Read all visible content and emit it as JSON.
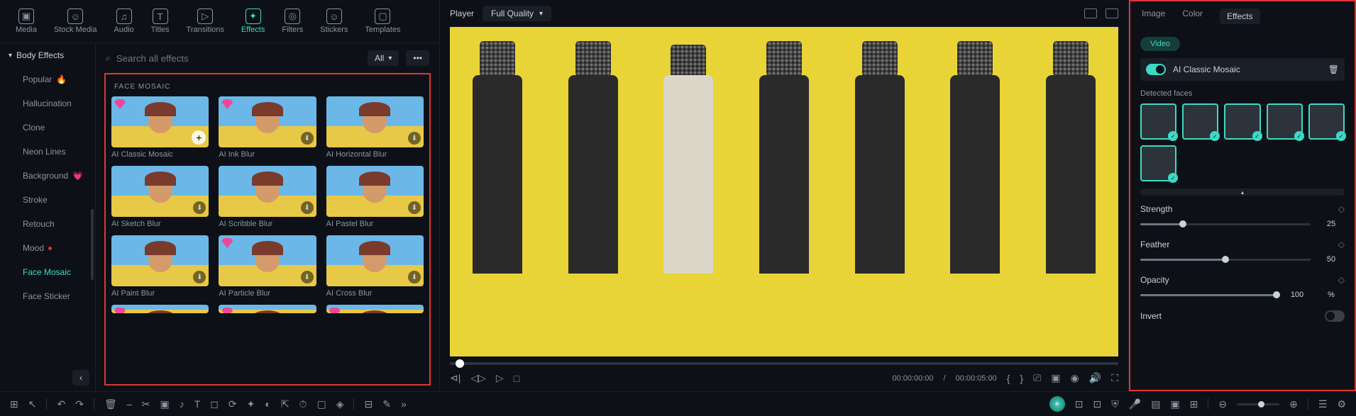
{
  "top_nav": [
    {
      "label": "Media",
      "icon": "▣"
    },
    {
      "label": "Stock Media",
      "icon": "☺"
    },
    {
      "label": "Audio",
      "icon": "♫"
    },
    {
      "label": "Titles",
      "icon": "T"
    },
    {
      "label": "Transitions",
      "icon": "▷"
    },
    {
      "label": "Effects",
      "icon": "✦",
      "active": true
    },
    {
      "label": "Filters",
      "icon": "◎"
    },
    {
      "label": "Stickers",
      "icon": "☺"
    },
    {
      "label": "Templates",
      "icon": "▢"
    }
  ],
  "sidebar": {
    "header": "Body Effects",
    "items": [
      {
        "label": "Popular",
        "emoji": "🔥"
      },
      {
        "label": "Hallucination"
      },
      {
        "label": "Clone"
      },
      {
        "label": "Neon Lines"
      },
      {
        "label": "Background",
        "emoji": "💗"
      },
      {
        "label": "Stroke"
      },
      {
        "label": "Retouch"
      },
      {
        "label": "Mood",
        "dot": true
      },
      {
        "label": "Face Mosaic",
        "active": true
      },
      {
        "label": "Face Sticker"
      }
    ]
  },
  "effects": {
    "search_placeholder": "Search all effects",
    "filter": "All",
    "section": "FACE MOSAIC",
    "items": [
      {
        "label": "AI Classic Mosaic",
        "gem": true,
        "add": true
      },
      {
        "label": "AI Ink Blur",
        "gem": true,
        "dl": true
      },
      {
        "label": "AI Horizontal Blur",
        "dl": true
      },
      {
        "label": "AI Sketch Blur",
        "dl": true
      },
      {
        "label": "AI Scribble Blur",
        "dl": true
      },
      {
        "label": "AI Pastel Blur",
        "dl": true
      },
      {
        "label": "AI Paint Blur",
        "dl": true
      },
      {
        "label": "AI Particle Blur",
        "gem": true,
        "dl": true
      },
      {
        "label": "AI Cross Blur",
        "dl": true
      }
    ]
  },
  "player": {
    "label": "Player",
    "quality": "Full Quality",
    "time_current": "00:00:00:00",
    "time_sep": "/",
    "time_total": "00:00:05:00"
  },
  "right": {
    "tabs": [
      "Image",
      "Color",
      "Effects"
    ],
    "active_tab": "Effects",
    "sub_tab": "Video",
    "effect_name": "AI Classic Mosaic",
    "detected_label": "Detected faces",
    "detected_count": 6,
    "params": {
      "strength": {
        "label": "Strength",
        "value": 25,
        "max": 100
      },
      "feather": {
        "label": "Feather",
        "value": 50,
        "max": 100
      },
      "opacity": {
        "label": "Opacity",
        "value": 100,
        "unit": "%",
        "max": 100
      }
    },
    "invert_label": "Invert"
  }
}
